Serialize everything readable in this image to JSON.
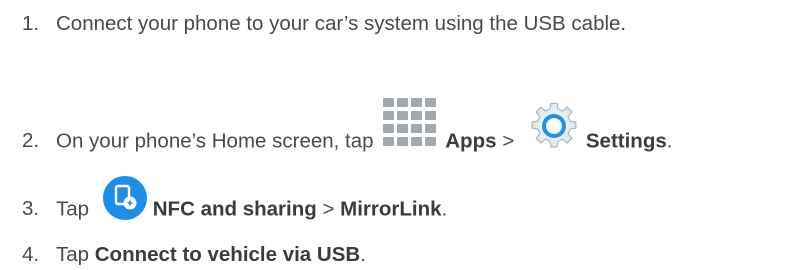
{
  "steps": [
    {
      "number": "1.",
      "text": "Connect your phone to your car’s system using the USB cable."
    },
    {
      "number": "2.",
      "prefix": "On your phone’s Home screen, tap ",
      "apps_label": "Apps",
      "separator": " > ",
      "settings_label": "Settings",
      "suffix": ".",
      "icons": [
        "apps-grid-icon",
        "settings-gear-icon"
      ]
    },
    {
      "number": "3.",
      "prefix": "Tap ",
      "nfc_label": "NFC and sharing",
      "separator": " > ",
      "mirrorlink_label": "MirrorLink",
      "suffix": ".",
      "icons": [
        "nfc-sharing-icon"
      ]
    },
    {
      "number": "4.",
      "prefix": "Tap ",
      "connect_label": "Connect to vehicle via USB",
      "suffix": "."
    }
  ],
  "colors": {
    "text": "#4a4a4a",
    "nfc_icon_blue": "#1f8ee6",
    "gear_blue": "#2b8fe0",
    "apps_grid": "#9ea3a8"
  }
}
